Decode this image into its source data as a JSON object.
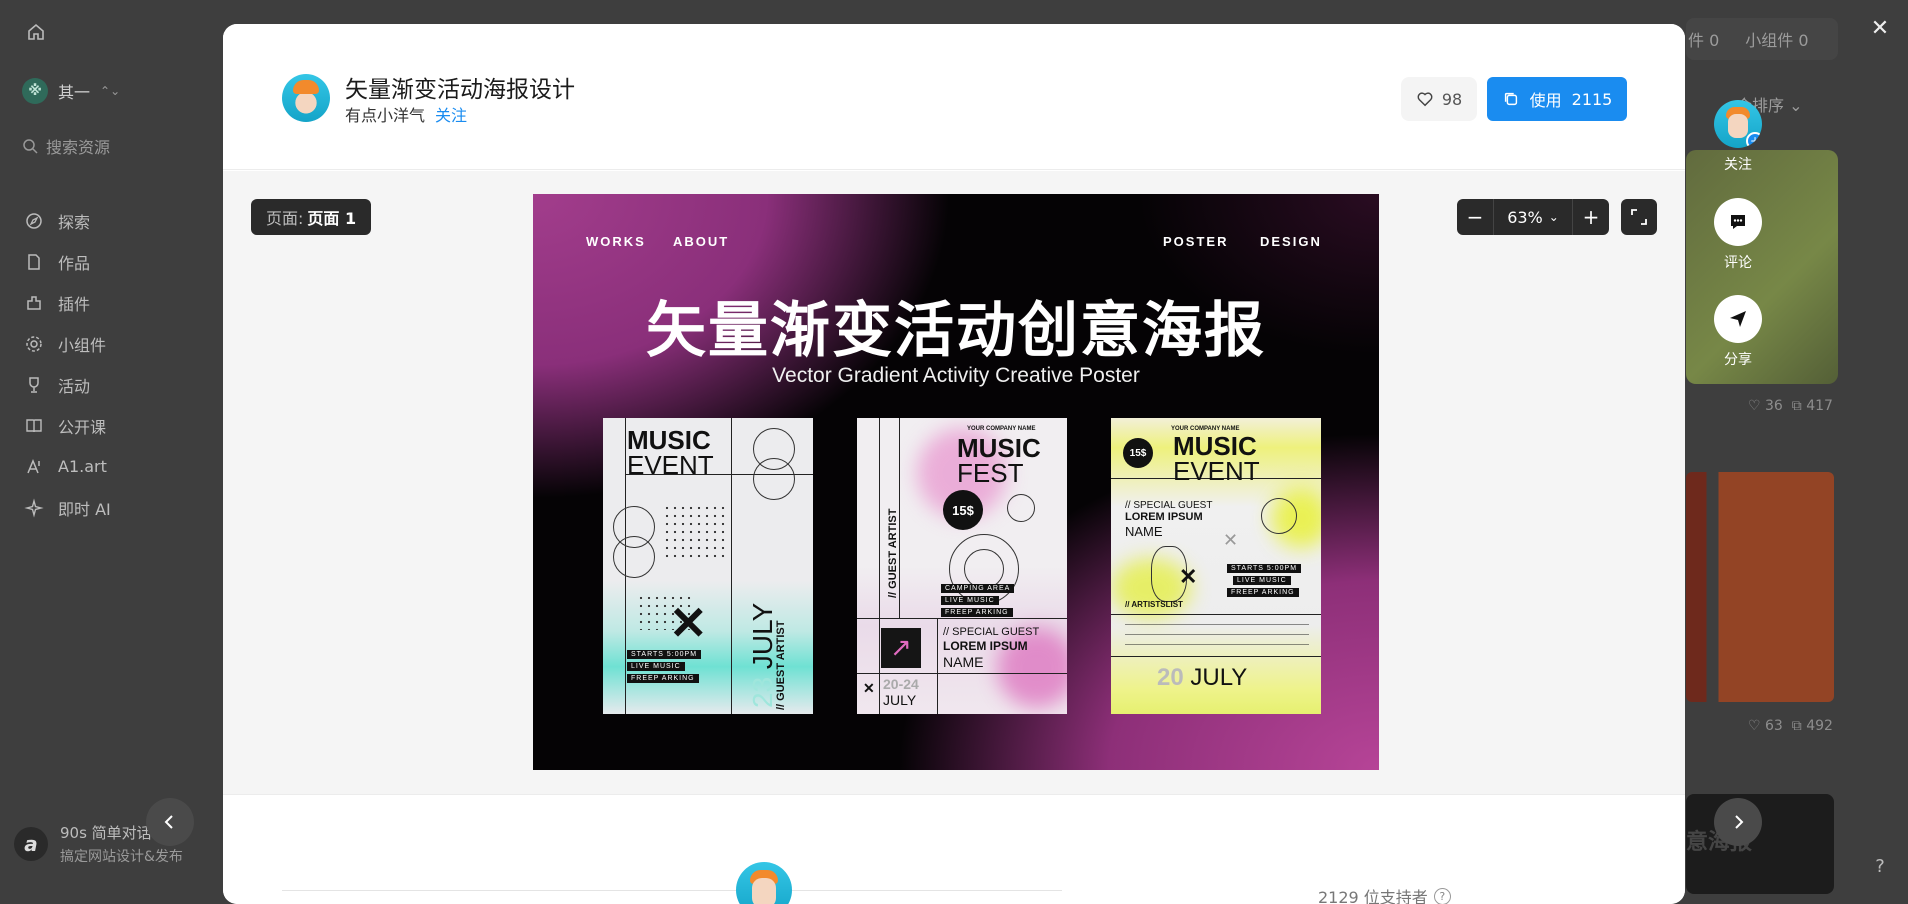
{
  "background": {
    "team_name": "其一",
    "search_placeholder": "搜索资源",
    "nav": [
      {
        "label": "探索",
        "icon": "compass-icon"
      },
      {
        "label": "作品",
        "icon": "file-icon"
      },
      {
        "label": "插件",
        "icon": "plugin-icon"
      },
      {
        "label": "小组件",
        "icon": "gear-icon"
      },
      {
        "label": "活动",
        "icon": "trophy-icon"
      },
      {
        "label": "公开课",
        "icon": "book-icon"
      },
      {
        "label": "A1.art",
        "icon": "ai-art-icon"
      },
      {
        "label": "即时 AI",
        "icon": "sparkle-icon"
      }
    ],
    "promo_title": "90s 简单对话",
    "promo_sub": "搞定网站设计&发布",
    "right_tabs": [
      "件 0",
      "小组件 0"
    ],
    "sort_label": "合排序",
    "card1_stats": {
      "likes": "36",
      "uses": "417"
    },
    "card2_stats": {
      "likes": "63",
      "uses": "492"
    },
    "card3_text": "意海报"
  },
  "modal": {
    "title": "矢量渐变活动海报设计",
    "author": "有点小洋气",
    "follow_label": "关注",
    "like_count": "98",
    "use_label": "使用",
    "use_count": "2115",
    "page_label": "页面:",
    "page_name": "页面 1",
    "zoom_value": "63%",
    "supporters_text": "2129 位支持者"
  },
  "poster": {
    "nav_left": [
      "WORKS",
      "ABOUT"
    ],
    "nav_right": [
      "POSTER",
      "DESIGN"
    ],
    "title": "矢量渐变活动创意海报",
    "subtitle": "Vector Gradient Activity Creative Poster",
    "card1": {
      "h1": "MUSIC",
      "h2": "EVENT",
      "date_num": "23",
      "month": "JULY",
      "guest": "// GUEST ARTIST",
      "bars": [
        "STARTS 5:00PM",
        "LIVE MUSIC",
        "FREEP ARKING"
      ]
    },
    "card2": {
      "company": "YOUR COMPANY NAME",
      "h1": "MUSIC",
      "h2": "FEST",
      "price": "15$",
      "special": "// SPECIAL GUEST",
      "lorem": "LOREM IPSUM",
      "name": "NAME",
      "dates": "20-24",
      "month": "JULY",
      "bars": [
        "CAMPING AREA",
        "LIVE MUSIC",
        "FREEP ARKING"
      ]
    },
    "card3": {
      "company": "YOUR COMPANY NAME",
      "h1": "MUSIC",
      "h2": "EVENT",
      "price": "15$",
      "special": "// SPECIAL GUEST",
      "lorem": "LOREM IPSUM",
      "name": "NAME",
      "artists": "// ARTISTSLIST",
      "day": "20",
      "month": "JULY",
      "bars": [
        "STARTS 5:00PM",
        "LIVE MUSIC",
        "FREEP ARKING"
      ]
    }
  },
  "side_actions": {
    "follow": "关注",
    "comment": "评论",
    "share": "分享"
  }
}
